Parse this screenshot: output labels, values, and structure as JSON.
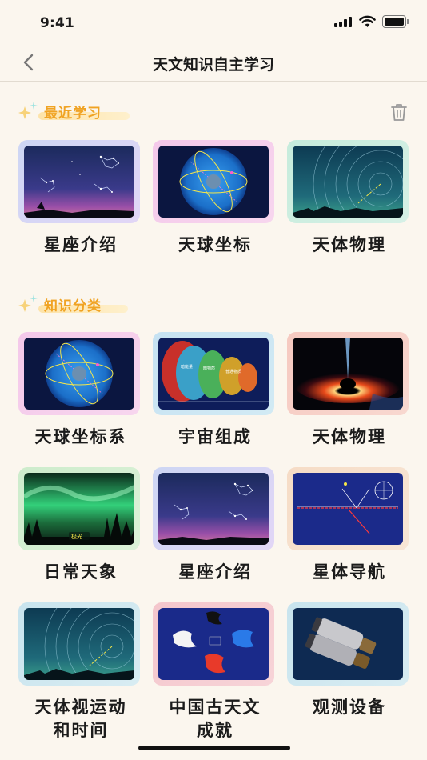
{
  "status_bar": {
    "time": "9:41"
  },
  "nav": {
    "title": "天文知识自主学习"
  },
  "recent": {
    "title": "最近学习",
    "items": [
      {
        "label": "星座介绍",
        "icon": "constellation-image"
      },
      {
        "label": "天球坐标",
        "icon": "celestial-sphere-image"
      },
      {
        "label": "天体物理",
        "icon": "star-trails-image"
      }
    ]
  },
  "categories": {
    "title": "知识分类",
    "items": [
      {
        "label": "天球坐标系",
        "icon": "celestial-sphere-image"
      },
      {
        "label": "宇宙组成",
        "icon": "cosmic-layers-image",
        "thumb_texts": [
          "暗能量",
          "暗物质",
          "普通物质"
        ]
      },
      {
        "label": "天体物理",
        "icon": "black-hole-image"
      },
      {
        "label": "日常天象",
        "icon": "aurora-image",
        "thumb_text": "极光"
      },
      {
        "label": "星座介绍",
        "icon": "constellation-image"
      },
      {
        "label": "星体导航",
        "icon": "navigation-diagram-image"
      },
      {
        "label": "天体视运动",
        "label2": "和时间",
        "icon": "star-trails-image"
      },
      {
        "label": "中国古天文",
        "label2": "成就",
        "icon": "chinese-four-symbols-image"
      },
      {
        "label": "观测设备",
        "icon": "binoculars-image"
      }
    ]
  }
}
